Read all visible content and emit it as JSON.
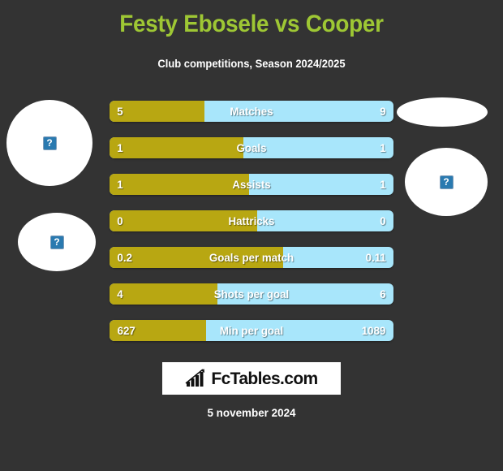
{
  "header": {
    "title": "Festy Ebosele vs Cooper",
    "subtitle": "Club competitions, Season 2024/2025",
    "title_color": "#9ec734",
    "subtitle_color": "#ffffff"
  },
  "theme": {
    "background": "#333333",
    "home_bar_color": "#b8a712",
    "away_bar_color": "#a8e6fb",
    "text_color": "#ffffff"
  },
  "photos": {
    "home_top": {
      "alt_glyph": "?"
    },
    "home_bottom": {
      "alt_glyph": "?"
    },
    "away_top": {
      "alt_glyph": ""
    },
    "away_bottom": {
      "alt_glyph": "?"
    }
  },
  "chart_data": {
    "type": "bar",
    "title": "Festy Ebosele vs Cooper",
    "subtitle": "Club competitions, Season 2024/2025",
    "orientation": "horizontal-diverging",
    "legend": [
      "Festy Ebosele",
      "Cooper"
    ],
    "categories": [
      "Matches",
      "Goals",
      "Assists",
      "Hattricks",
      "Goals per match",
      "Shots per goal",
      "Min per goal"
    ],
    "series": [
      {
        "name": "Festy Ebosele",
        "color": "#b8a712",
        "values": [
          "5",
          "1",
          "1",
          "0",
          "0.2",
          "4",
          "627"
        ]
      },
      {
        "name": "Cooper",
        "color": "#a8e6fb",
        "values": [
          "9",
          "1",
          "1",
          "0",
          "0.11",
          "6",
          "1089"
        ]
      }
    ],
    "home_fill_percent": [
      33.5,
      47.0,
      49.0,
      52.0,
      61.0,
      38.0,
      34.0
    ]
  },
  "rows": [
    {
      "label": "Matches",
      "home": "5",
      "away": "9",
      "fill": 33.5
    },
    {
      "label": "Goals",
      "home": "1",
      "away": "1",
      "fill": 47.0
    },
    {
      "label": "Assists",
      "home": "1",
      "away": "1",
      "fill": 49.0
    },
    {
      "label": "Hattricks",
      "home": "0",
      "away": "0",
      "fill": 52.0
    },
    {
      "label": "Goals per match",
      "home": "0.2",
      "away": "0.11",
      "fill": 61.0
    },
    {
      "label": "Shots per goal",
      "home": "4",
      "away": "6",
      "fill": 38.0
    },
    {
      "label": "Min per goal",
      "home": "627",
      "away": "1089",
      "fill": 34.0
    }
  ],
  "footer": {
    "logo_text": "FcTables.com",
    "logo_icon": "bar-chart-arrow-icon",
    "date": "5 november 2024"
  }
}
